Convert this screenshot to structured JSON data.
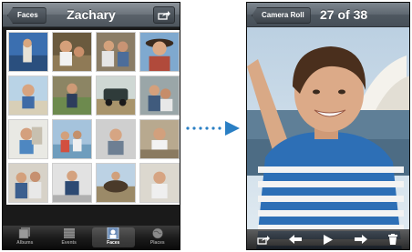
{
  "left_screen": {
    "nav": {
      "back_label": "Faces",
      "title": "Zachary",
      "action_icon": "share-icon"
    },
    "grid": {
      "rows": 4,
      "columns": 4
    },
    "tabs": [
      {
        "label": "Albums",
        "icon": "albums-icon",
        "active": false
      },
      {
        "label": "Events",
        "icon": "events-icon",
        "active": false
      },
      {
        "label": "Faces",
        "icon": "faces-icon",
        "active": true
      },
      {
        "label": "Places",
        "icon": "places-icon",
        "active": false
      }
    ]
  },
  "arrow": {
    "icon": "dotted-arrow-right-icon"
  },
  "right_screen": {
    "nav": {
      "back_label": "Camera Roll",
      "title": "27 of 38"
    },
    "toolbar": [
      {
        "icon": "share-icon"
      },
      {
        "icon": "previous-arrow-icon"
      },
      {
        "icon": "play-icon"
      },
      {
        "icon": "next-arrow-icon"
      },
      {
        "icon": "trash-icon"
      }
    ]
  },
  "colors": {
    "nav_gradient_top": "#8c939a",
    "nav_gradient_bottom": "#4e565e",
    "tab_active_label": "#ffffff",
    "tab_inactive_label": "#9a9a9a",
    "arrow_blue": "#2a7fc4"
  }
}
